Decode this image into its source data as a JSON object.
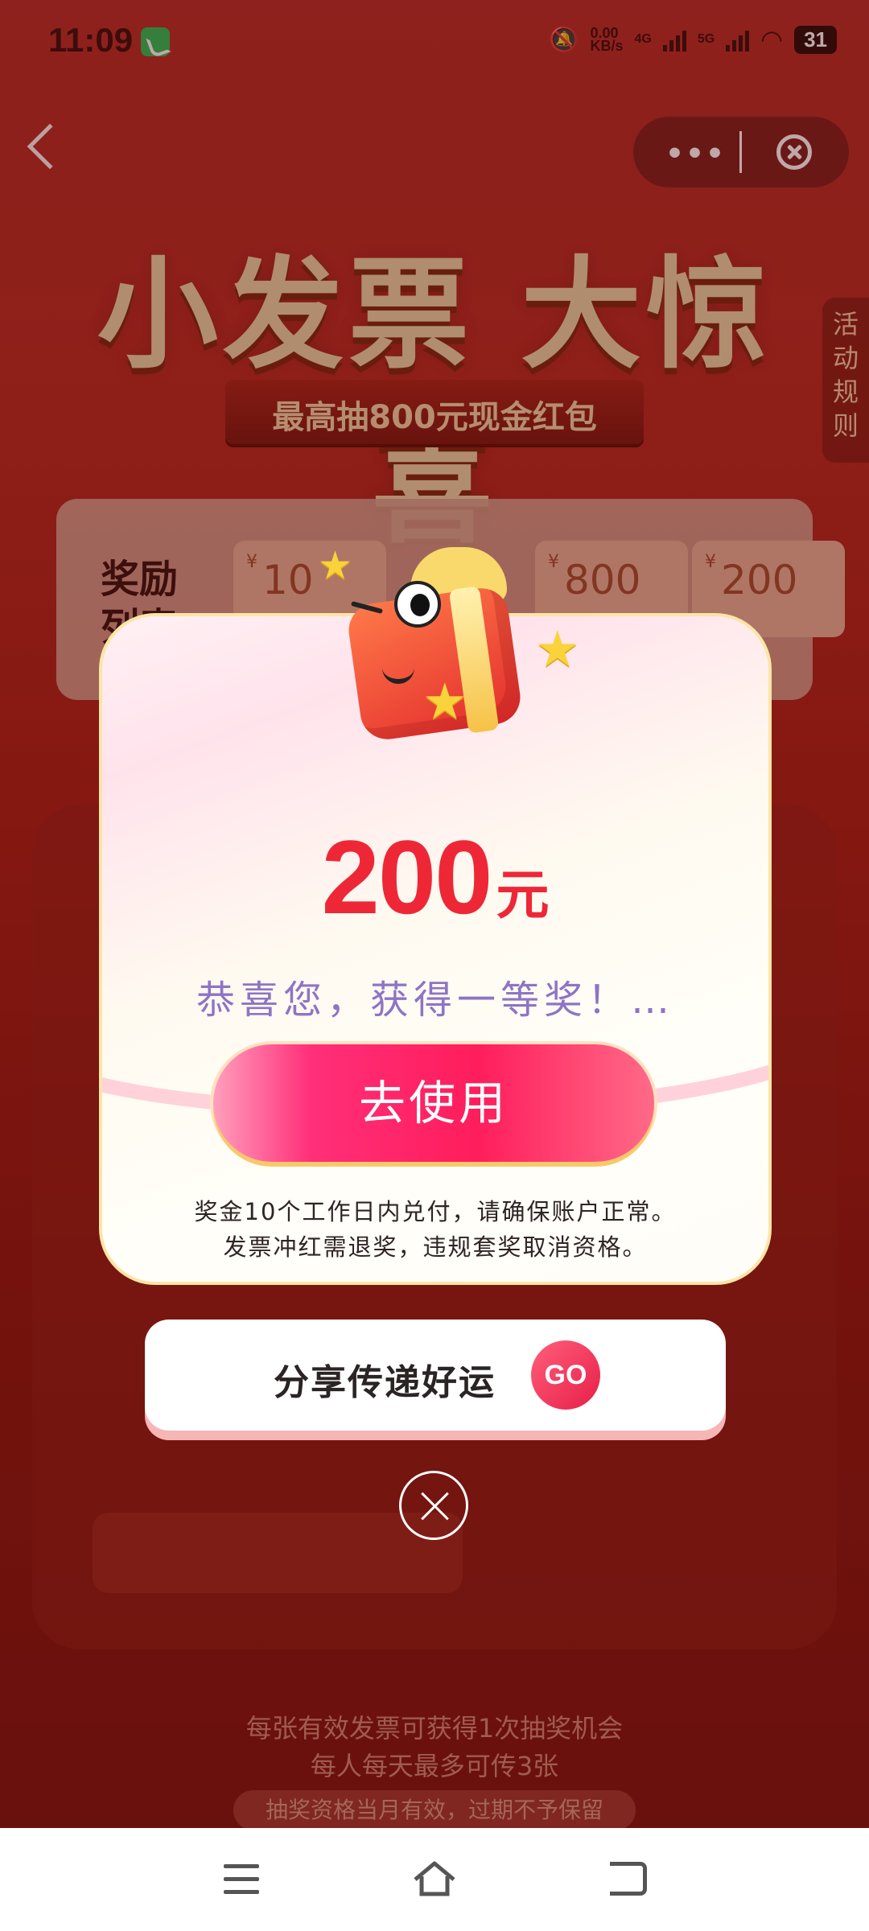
{
  "status_bar": {
    "time": "11:09",
    "net_speed": "0.00\nKB/s",
    "net_4g": "4G",
    "net_5g": "5G",
    "battery": "31"
  },
  "nav": {
    "more_label": "•••"
  },
  "hero": {
    "title": "小发票 大惊喜",
    "subtitle": "最高抽800元现金红包"
  },
  "side_tab": {
    "label": "活动规则"
  },
  "rewards": {
    "label": "奖励列表",
    "items": [
      {
        "currency": "¥",
        "amount": "10"
      },
      {
        "currency": "¥",
        "amount": "800"
      },
      {
        "currency": "¥",
        "amount": "200"
      }
    ]
  },
  "modal": {
    "amount": "200",
    "unit": "元",
    "congrats": "恭喜您，获得一等奖！…",
    "use_button": "去使用",
    "rule1": "奖金10个工作日内兑付，请确保账户正常。",
    "rule2": "发票冲红需退奖，违规套奖取消资格。"
  },
  "share": {
    "label": "分享传递好运",
    "go": "GO"
  },
  "footer": {
    "note1": "每张有效发票可获得1次抽奖机会",
    "note2": "每人每天最多可传3张",
    "pill": "抽奖资格当月有效，过期不予保留"
  },
  "colors": {
    "accent_red": "#ee2737",
    "button_pink": "#ff1d5c",
    "congrats_purple": "#8e74c5"
  }
}
